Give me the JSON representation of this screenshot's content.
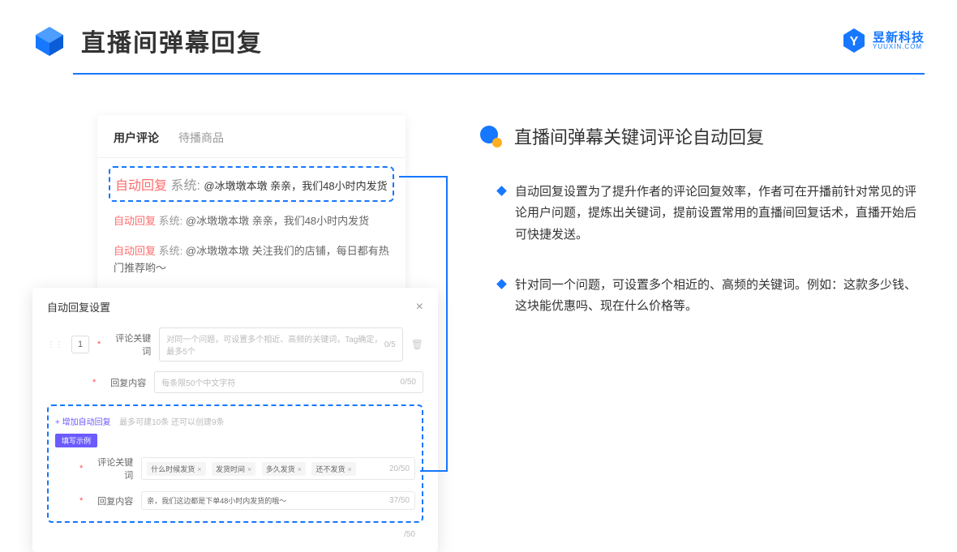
{
  "header": {
    "title": "直播间弹幕回复",
    "brand_main": "昱新科技",
    "brand_sub": "YUUXIN.COM"
  },
  "comments": {
    "tab_active": "用户评论",
    "tab_inactive": "待播商品",
    "rows": [
      {
        "tag": "自动回复",
        "sys": "系统:",
        "text": "@冰墩墩本墩 亲亲，我们48小时内发货"
      },
      {
        "tag": "自动回复",
        "sys": "系统:",
        "text": "@冰墩墩本墩 亲亲，我们48小时内发货"
      },
      {
        "tag": "自动回复",
        "sys": "系统:",
        "text": "@冰墩墩本墩 关注我们的店铺，每日都有热门推荐哟～"
      }
    ]
  },
  "settings": {
    "title": "自动回复设置",
    "idx": "1",
    "kw_label": "评论关键词",
    "kw_placeholder": "对同一个问题，可设置多个相近、高频的关键词，Tag确定，最多5个",
    "kw_count": "0/5",
    "content_label": "回复内容",
    "content_placeholder": "每条限50个中文字符",
    "content_count": "0/50",
    "add_link": "+ 增加自动回复",
    "add_hint": "最多可建10条 还可以创建9条",
    "badge": "填写示例",
    "ex_kw_label": "评论关键词",
    "ex_tags": [
      "什么时候发货",
      "发货时间",
      "多久发货",
      "还不发货"
    ],
    "ex_kw_count": "20/50",
    "ex_content_label": "回复内容",
    "ex_content_text": "亲，我们这边都是下单48小时内发货的哦～",
    "ex_content_count": "37/50",
    "outer_count": "/50"
  },
  "right": {
    "section_title": "直播间弹幕关键词评论自动回复",
    "bullets": [
      "自动回复设置为了提升作者的评论回复效率，作者可在开播前针对常见的评论用户问题，提炼出关键词，提前设置常用的直播间回复话术，直播开始后可快捷发送。",
      "针对同一个问题，可设置多个相近的、高频的关键词。例如：这款多少钱、这块能优惠吗、现在什么价格等。"
    ]
  }
}
